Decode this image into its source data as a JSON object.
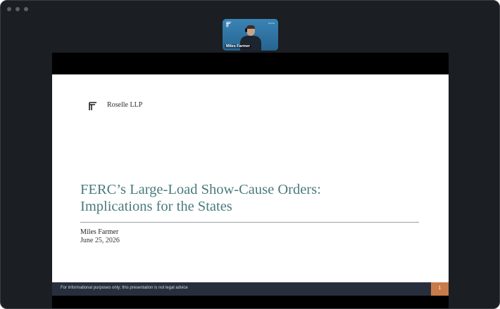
{
  "colors": {
    "window_bg": "#1b1e22",
    "tile_bg": "#2e6f9a",
    "title_teal": "#4a7a7c",
    "footer_bg": "#272f3d",
    "page_accent": "#c97b4a"
  },
  "participant": {
    "name": "Miles Farmer",
    "brand": "Roselle"
  },
  "slide": {
    "firm_name": "Roselle LLP",
    "title_line1": "FERC’s Large-Load Show-Cause Orders:",
    "title_line2": "Implications for the States",
    "presenter": "Miles Farmer",
    "date": "June 25, 2026",
    "disclaimer": "For informational purposes only; this presentation is not legal advice",
    "page_number": "1"
  },
  "icons": {
    "window_controls": [
      "window-dot-icon",
      "window-dot-icon",
      "window-dot-icon"
    ],
    "firm_logo": "roselle-logo-icon"
  }
}
